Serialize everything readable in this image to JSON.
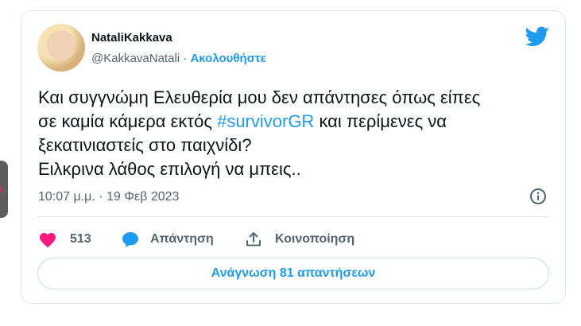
{
  "author": {
    "display_name": "NataliKakkava",
    "handle": "@KakkavaNatali",
    "separator": " · ",
    "follow_label": "Ακολουθήστε"
  },
  "tweet": {
    "text_line1": "Και συγγνώμη Ελευθερία μου δεν απάντησες όπως είπες",
    "text_line2_before": "σε καμία κάμερα εκτός ",
    "hashtag": "#survivorGR",
    "text_line2_after": " και περίμενες να",
    "text_line3": "ξεκατινιαστείς στο παιχνίδι?",
    "text_line4": "Ειλκρινα λάθος επιλογή να μπεις.."
  },
  "meta": {
    "timestamp": "10:07 μ.μ. · 19 Φεβ 2023"
  },
  "actions": {
    "like_count": "513",
    "reply_label": "Απάντηση",
    "share_label": "Κοινοποίηση"
  },
  "read_replies_label": "Ανάγνωση 81 απαντήσεων",
  "side_tab_glyph": "x",
  "colors": {
    "link": "#1d9bf0",
    "like": "#f91880",
    "secondary_text": "#536471",
    "primary_text": "#0f1419",
    "border": "#e1e8ed"
  }
}
